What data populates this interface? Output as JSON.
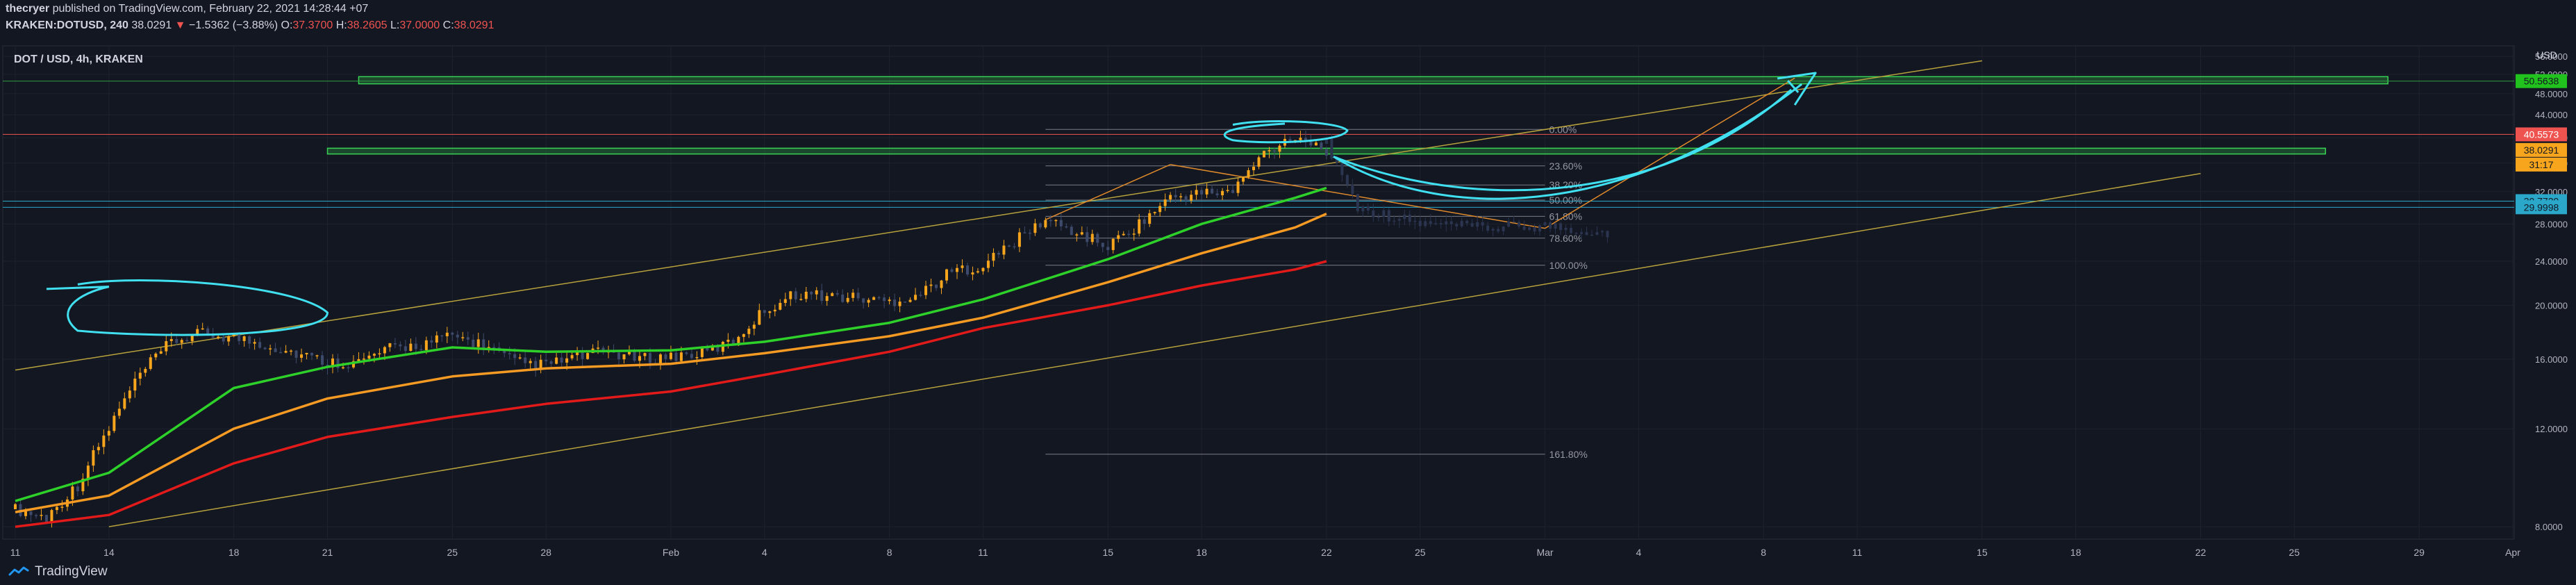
{
  "header": {
    "author": "thecryer",
    "published_text": " published on TradingView.com, February 22, 2021 14:28:44 +07",
    "symbol": "KRAKEN:DOTUSD, 240",
    "last": "38.0291",
    "change_arrow": "▼",
    "change": "−1.5362 (−3.88%)",
    "o_label": "O:",
    "o_value": "37.3700",
    "h_label": "H:",
    "h_value": "38.2605",
    "l_label": "L:",
    "l_value": "37.0000",
    "c_label": "C:",
    "c_value": "38.0291"
  },
  "footer": {
    "brand": "TradingView"
  },
  "colors": {
    "background": "#131722",
    "grid": "#1e222d",
    "up_candle": "#f7a51c",
    "down_candle": "#3d4a6b",
    "ma_fast": "#2ed12a",
    "ma_mid": "#f59a23",
    "ma_slow": "#e31a1a",
    "zone": "#2ea043",
    "cyan_drawing": "#40e0f0",
    "trendline": "#b8a23c",
    "fib": "#7a7d85"
  },
  "chart_data": {
    "type": "candlestick",
    "title": "DOT / USD, 4h, KRAKEN",
    "y_axis_title": "USD",
    "scale": "log",
    "ylim": [
      7.6,
      58.5
    ],
    "y_ticks": [
      8,
      12,
      16,
      20,
      24,
      28,
      32,
      36,
      40,
      44,
      48,
      52,
      56
    ],
    "y_tick_labels": [
      "8.0000",
      "12.0000",
      "16.0000",
      "20.0000",
      "24.0000",
      "28.0000",
      "32.0000",
      "36.0000",
      "40.0000",
      "44.0000",
      "48.0000",
      "52.0000",
      "56.0000"
    ],
    "x_range": [
      "2021-01-11",
      "2021-04-01"
    ],
    "x_ticks": [
      {
        "date": "2021-01-11",
        "label": "11"
      },
      {
        "date": "2021-01-14",
        "label": "14"
      },
      {
        "date": "2021-01-18",
        "label": "18"
      },
      {
        "date": "2021-01-21",
        "label": "21"
      },
      {
        "date": "2021-01-25",
        "label": "25"
      },
      {
        "date": "2021-01-28",
        "label": "28"
      },
      {
        "date": "2021-02-01",
        "label": "Feb"
      },
      {
        "date": "2021-02-04",
        "label": "4"
      },
      {
        "date": "2021-02-08",
        "label": "8"
      },
      {
        "date": "2021-02-11",
        "label": "11"
      },
      {
        "date": "2021-02-15",
        "label": "15"
      },
      {
        "date": "2021-02-18",
        "label": "18"
      },
      {
        "date": "2021-02-22",
        "label": "22"
      },
      {
        "date": "2021-02-25",
        "label": "25"
      },
      {
        "date": "2021-03-01",
        "label": "Mar"
      },
      {
        "date": "2021-03-04",
        "label": "4"
      },
      {
        "date": "2021-03-08",
        "label": "8"
      },
      {
        "date": "2021-03-11",
        "label": "11"
      },
      {
        "date": "2021-03-15",
        "label": "15"
      },
      {
        "date": "2021-03-18",
        "label": "18"
      },
      {
        "date": "2021-03-22",
        "label": "22"
      },
      {
        "date": "2021-03-25",
        "label": "25"
      },
      {
        "date": "2021-03-29",
        "label": "29"
      },
      {
        "date": "2021-04-01",
        "label": "Apr"
      }
    ],
    "price_path": [
      {
        "date": "2021-01-11",
        "price": 8.6
      },
      {
        "date": "2021-01-12",
        "price": 8.3
      },
      {
        "date": "2021-01-13",
        "price": 9.5
      },
      {
        "date": "2021-01-14",
        "price": 12.0
      },
      {
        "date": "2021-01-15",
        "price": 15.0
      },
      {
        "date": "2021-01-16",
        "price": 17.2
      },
      {
        "date": "2021-01-17",
        "price": 17.8
      },
      {
        "date": "2021-01-18",
        "price": 17.5
      },
      {
        "date": "2021-01-19",
        "price": 17.0
      },
      {
        "date": "2021-01-20",
        "price": 16.4
      },
      {
        "date": "2021-01-21",
        "price": 15.8
      },
      {
        "date": "2021-01-22",
        "price": 15.8
      },
      {
        "date": "2021-01-23",
        "price": 16.7
      },
      {
        "date": "2021-01-24",
        "price": 17.0
      },
      {
        "date": "2021-01-25",
        "price": 17.6
      },
      {
        "date": "2021-01-26",
        "price": 17.0
      },
      {
        "date": "2021-01-27",
        "price": 15.8
      },
      {
        "date": "2021-01-28",
        "price": 15.6
      },
      {
        "date": "2021-01-29",
        "price": 16.2
      },
      {
        "date": "2021-01-30",
        "price": 16.5
      },
      {
        "date": "2021-01-31",
        "price": 16.0
      },
      {
        "date": "2021-02-01",
        "price": 16.2
      },
      {
        "date": "2021-02-02",
        "price": 16.4
      },
      {
        "date": "2021-02-03",
        "price": 17.2
      },
      {
        "date": "2021-02-04",
        "price": 19.6
      },
      {
        "date": "2021-02-05",
        "price": 21.0
      },
      {
        "date": "2021-02-06",
        "price": 20.8
      },
      {
        "date": "2021-02-07",
        "price": 20.6
      },
      {
        "date": "2021-02-08",
        "price": 20.3
      },
      {
        "date": "2021-02-09",
        "price": 21.0
      },
      {
        "date": "2021-02-10",
        "price": 23.0
      },
      {
        "date": "2021-02-11",
        "price": 23.6
      },
      {
        "date": "2021-02-12",
        "price": 26.0
      },
      {
        "date": "2021-02-13",
        "price": 28.5
      },
      {
        "date": "2021-02-14",
        "price": 27.0
      },
      {
        "date": "2021-02-15",
        "price": 25.5
      },
      {
        "date": "2021-02-16",
        "price": 28.0
      },
      {
        "date": "2021-02-17",
        "price": 31.2
      },
      {
        "date": "2021-02-18",
        "price": 31.8
      },
      {
        "date": "2021-02-19",
        "price": 32.0
      },
      {
        "date": "2021-02-20",
        "price": 37.5
      },
      {
        "date": "2021-02-21",
        "price": 40.5
      },
      {
        "date": "2021-02-22",
        "price": 38.03
      }
    ],
    "moving_averages": [
      {
        "name": "fast",
        "points": [
          {
            "date": "2021-01-11",
            "value": 8.9
          },
          {
            "date": "2021-01-14",
            "value": 10.0
          },
          {
            "date": "2021-01-18",
            "value": 14.2
          },
          {
            "date": "2021-01-21",
            "value": 15.5
          },
          {
            "date": "2021-01-25",
            "value": 16.8
          },
          {
            "date": "2021-01-28",
            "value": 16.5
          },
          {
            "date": "2021-02-01",
            "value": 16.6
          },
          {
            "date": "2021-02-04",
            "value": 17.2
          },
          {
            "date": "2021-02-08",
            "value": 18.6
          },
          {
            "date": "2021-02-11",
            "value": 20.5
          },
          {
            "date": "2021-02-15",
            "value": 24.2
          },
          {
            "date": "2021-02-18",
            "value": 28.0
          },
          {
            "date": "2021-02-21",
            "value": 31.2
          },
          {
            "date": "2021-02-22",
            "value": 32.5
          }
        ]
      },
      {
        "name": "mid",
        "points": [
          {
            "date": "2021-01-11",
            "value": 8.5
          },
          {
            "date": "2021-01-14",
            "value": 9.1
          },
          {
            "date": "2021-01-18",
            "value": 12.0
          },
          {
            "date": "2021-01-21",
            "value": 13.6
          },
          {
            "date": "2021-01-25",
            "value": 14.9
          },
          {
            "date": "2021-01-28",
            "value": 15.4
          },
          {
            "date": "2021-02-01",
            "value": 15.7
          },
          {
            "date": "2021-02-04",
            "value": 16.4
          },
          {
            "date": "2021-02-08",
            "value": 17.6
          },
          {
            "date": "2021-02-11",
            "value": 19.0
          },
          {
            "date": "2021-02-15",
            "value": 22.0
          },
          {
            "date": "2021-02-18",
            "value": 24.8
          },
          {
            "date": "2021-02-21",
            "value": 27.6
          },
          {
            "date": "2021-02-22",
            "value": 29.2
          }
        ]
      },
      {
        "name": "slow",
        "points": [
          {
            "date": "2021-01-11",
            "value": 8.0
          },
          {
            "date": "2021-01-14",
            "value": 8.4
          },
          {
            "date": "2021-01-18",
            "value": 10.4
          },
          {
            "date": "2021-01-21",
            "value": 11.6
          },
          {
            "date": "2021-01-25",
            "value": 12.6
          },
          {
            "date": "2021-01-28",
            "value": 13.3
          },
          {
            "date": "2021-02-01",
            "value": 14.0
          },
          {
            "date": "2021-02-04",
            "value": 15.0
          },
          {
            "date": "2021-02-08",
            "value": 16.5
          },
          {
            "date": "2021-02-11",
            "value": 18.2
          },
          {
            "date": "2021-02-15",
            "value": 20.0
          },
          {
            "date": "2021-02-18",
            "value": 21.7
          },
          {
            "date": "2021-02-21",
            "value": 23.2
          },
          {
            "date": "2021-02-22",
            "value": 24.0
          }
        ]
      }
    ],
    "projection_path": [
      {
        "date": "2021-02-22",
        "price": 39.0
      },
      {
        "date": "2021-02-23",
        "price": 30.0
      },
      {
        "date": "2021-02-25",
        "price": 28.0
      },
      {
        "date": "2021-02-27",
        "price": 27.5
      },
      {
        "date": "2021-03-01",
        "price": 27.8
      },
      {
        "date": "2021-03-03",
        "price": 27.0
      }
    ],
    "fibonacci": {
      "date_start": "2021-02-13",
      "date_end": "2021-03-01",
      "levels": [
        {
          "label": "0.00%",
          "price": 41.4
        },
        {
          "label": "23.60%",
          "price": 35.6
        },
        {
          "label": "38.20%",
          "price": 32.9
        },
        {
          "label": "50.00%",
          "price": 30.9
        },
        {
          "label": "61.80%",
          "price": 28.9
        },
        {
          "label": "78.60%",
          "price": 26.4
        },
        {
          "label": "100.00%",
          "price": 23.6
        },
        {
          "label": "161.80%",
          "price": 10.8
        }
      ]
    },
    "zones": [
      {
        "date_start": "2021-01-22",
        "date_end": "2021-03-28",
        "low": 50.0,
        "high": 51.5
      },
      {
        "date_start": "2021-01-21",
        "date_end": "2021-03-26",
        "low": 37.4,
        "high": 38.3
      }
    ],
    "trendlines": [
      {
        "from": {
          "date": "2021-01-11",
          "price": 15.3
        },
        "to": {
          "date": "2021-03-15",
          "price": 55.0
        }
      },
      {
        "from": {
          "date": "2021-01-14",
          "price": 8.0
        },
        "to": {
          "date": "2021-03-22",
          "price": 34.5
        }
      }
    ],
    "horizontal_lines": [
      {
        "price": 40.5573,
        "color": "#ef5350"
      },
      {
        "price": 30.7729,
        "color": "#2aa7c9"
      },
      {
        "price": 29.9998,
        "color": "#2aa7c9"
      },
      {
        "price": 50.5638,
        "color": "#2ea043"
      }
    ],
    "price_labels": [
      {
        "text": "50.5638",
        "price": 50.5638,
        "bg": "#21c21d",
        "fg": "#131722"
      },
      {
        "text": "40.5573",
        "price": 40.5573,
        "bg": "#ef5350",
        "fg": "#ffffff"
      },
      {
        "text": "38.0291",
        "price": 38.0291,
        "bg": "#f7a51c",
        "fg": "#131722"
      },
      {
        "text": "31:17",
        "price": 35.8,
        "bg": "#f7a51c",
        "fg": "#131722"
      },
      {
        "text": "30.7729",
        "price": 30.7729,
        "bg": "#2aa7c9",
        "fg": "#131722"
      },
      {
        "text": "29.9998",
        "price": 29.9998,
        "bg": "#2aa7c9",
        "fg": "#131722"
      }
    ]
  }
}
